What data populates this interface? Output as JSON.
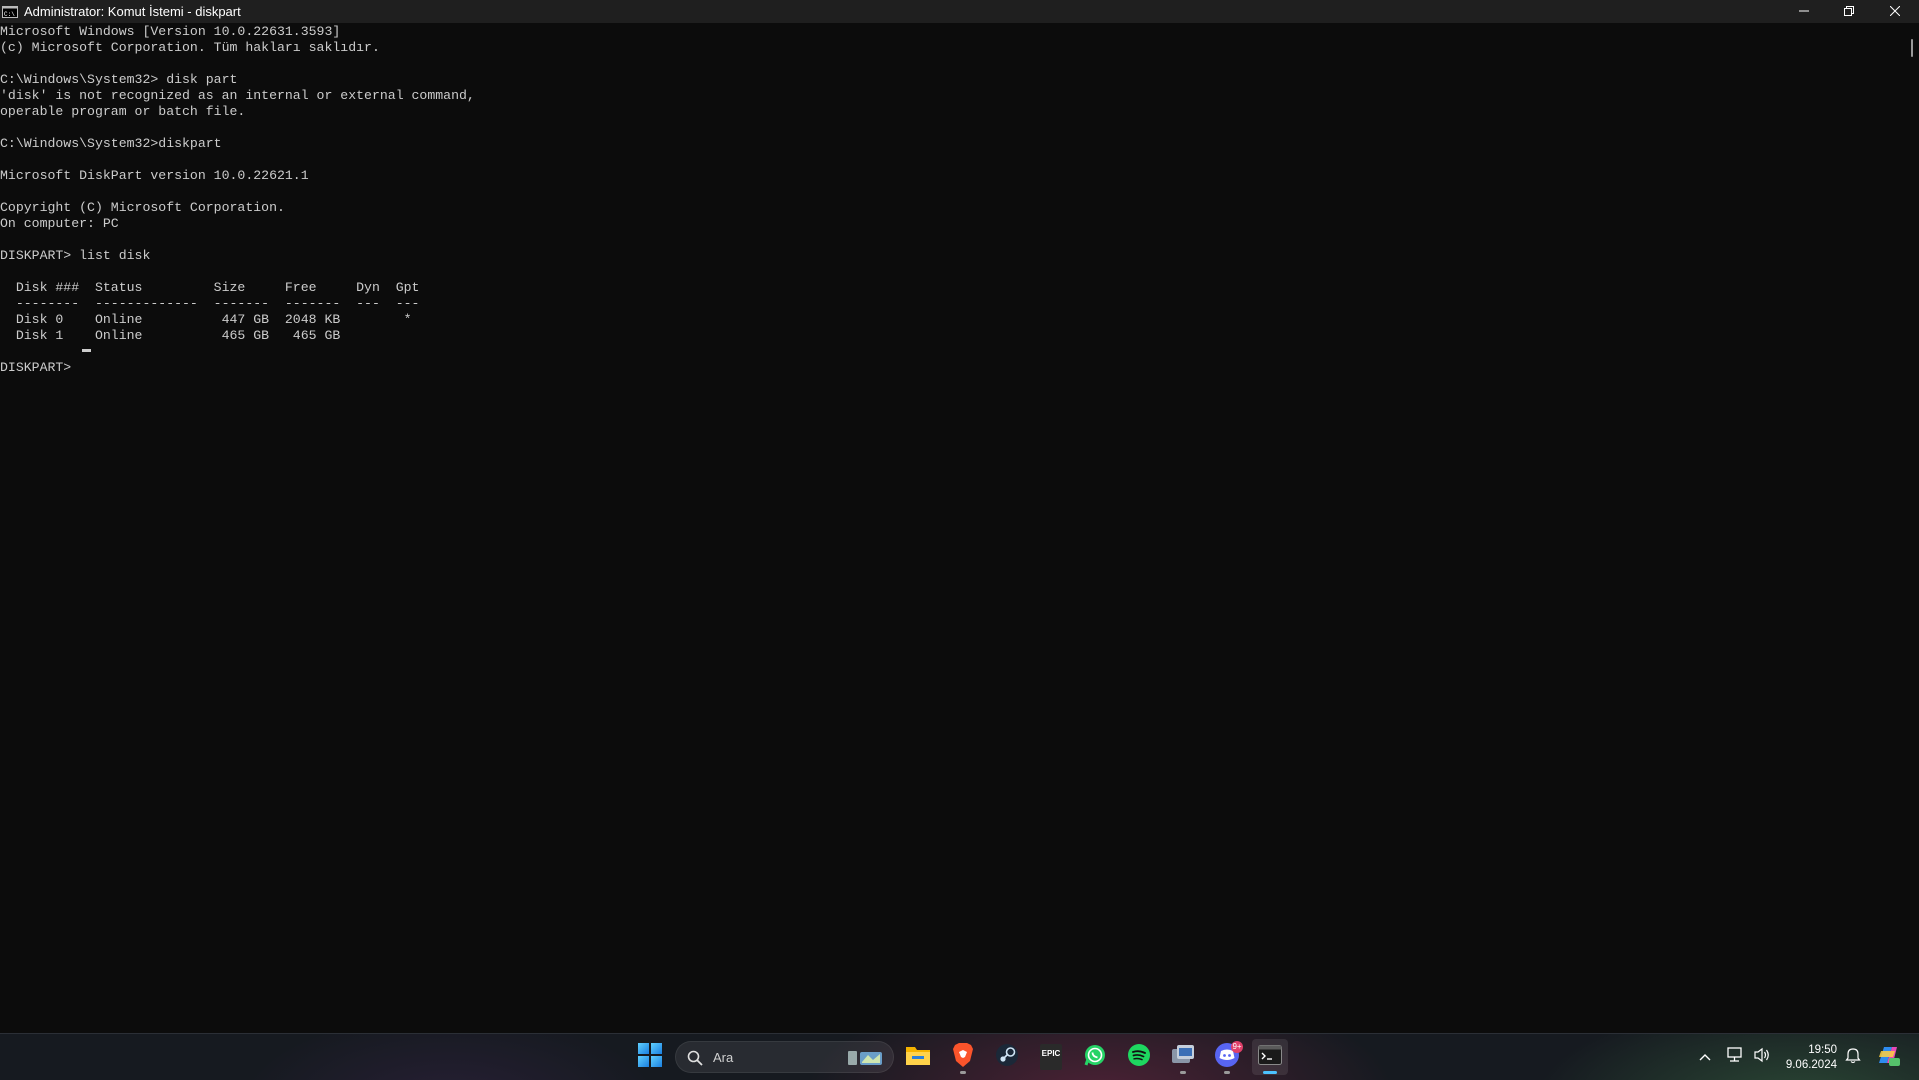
{
  "window": {
    "title": "Administrator: Komut İstemi - diskpart",
    "app_icon": "cmd-icon",
    "controls": {
      "minimize": "minimize-icon",
      "maximize": "restore-icon",
      "close": "close-icon"
    }
  },
  "console": {
    "lines": [
      "Microsoft Windows [Version 10.0.22631.3593]",
      "(c) Microsoft Corporation. Tüm hakları saklıdır.",
      "",
      "C:\\Windows\\System32> disk part",
      "'disk' is not recognized as an internal or external command,",
      "operable program or batch file.",
      "",
      "C:\\Windows\\System32>diskpart",
      "",
      "Microsoft DiskPart version 10.0.22621.1",
      "",
      "Copyright (C) Microsoft Corporation.",
      "On computer: PC",
      "",
      "DISKPART> list disk",
      "",
      "  Disk ###  Status         Size     Free     Dyn  Gpt",
      "  --------  -------------  -------  -------  ---  ---",
      "  Disk 0    Online          447 GB  2048 KB        *",
      "  Disk 1    Online          465 GB   465 GB",
      "",
      "DISKPART> "
    ],
    "colors": {
      "background": "#0c0c0c",
      "text": "#cccccc"
    }
  },
  "taskbar": {
    "start_icon": "windows-start-icon",
    "search": {
      "placeholder": "Ara",
      "icon": "search-icon"
    },
    "apps": [
      {
        "name": "file-explorer",
        "icon": "folder-icon",
        "running": false
      },
      {
        "name": "brave",
        "icon": "brave-lion-icon",
        "running": true
      },
      {
        "name": "steam",
        "icon": "steam-icon",
        "running": false
      },
      {
        "name": "epic-games",
        "icon": "epic-games-icon",
        "label": "EPIC",
        "running": false
      },
      {
        "name": "whatsapp",
        "icon": "whatsapp-icon",
        "running": false
      },
      {
        "name": "spotify",
        "icon": "spotify-icon",
        "running": false
      },
      {
        "name": "app-window",
        "icon": "app-window-icon",
        "running": true
      },
      {
        "name": "discord",
        "icon": "discord-icon",
        "badge": "9+",
        "running": true
      },
      {
        "name": "terminal",
        "icon": "terminal-icon",
        "running": true,
        "active": true
      }
    ],
    "tray": {
      "chevron": "chevron-up-icon",
      "network": "network-icon",
      "volume": "volume-icon",
      "time": "19:50",
      "date": "9.06.2024",
      "notifications": "bell-icon",
      "copilot": "copilot-icon"
    },
    "colors": {
      "accent": "#4cc2ff",
      "badge": "#e0406a"
    }
  }
}
